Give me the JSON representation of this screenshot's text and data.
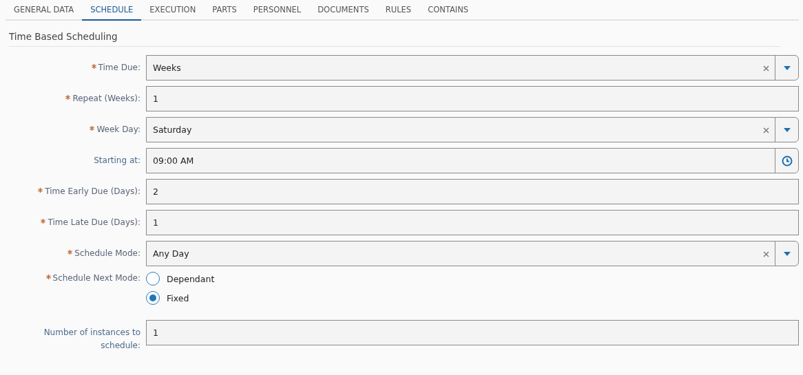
{
  "tabs": [
    {
      "label": "GENERAL DATA",
      "selected": false
    },
    {
      "label": "SCHEDULE",
      "selected": true
    },
    {
      "label": "EXECUTION",
      "selected": false
    },
    {
      "label": "PARTS",
      "selected": false
    },
    {
      "label": "PERSONNEL",
      "selected": false
    },
    {
      "label": "DOCUMENTS",
      "selected": false
    },
    {
      "label": "RULES",
      "selected": false
    },
    {
      "label": "CONTAINS",
      "selected": false
    }
  ],
  "section": {
    "title": "Time Based Scheduling"
  },
  "fields": [
    {
      "kind": "select",
      "label": "Time Due:",
      "required": true,
      "value": "Weeks"
    },
    {
      "kind": "text",
      "label": "Repeat (Weeks):",
      "required": true,
      "value": "1"
    },
    {
      "kind": "select",
      "label": "Week Day:",
      "required": true,
      "value": "Saturday"
    },
    {
      "kind": "time",
      "label": "Starting at:",
      "required": false,
      "value": "09:00 AM"
    },
    {
      "kind": "text",
      "label": "Time Early Due (Days):",
      "required": true,
      "value": "2"
    },
    {
      "kind": "text",
      "label": "Time Late Due (Days):",
      "required": true,
      "value": "1"
    },
    {
      "kind": "select",
      "label": "Schedule Mode:",
      "required": true,
      "value": "Any Day"
    },
    {
      "kind": "radio",
      "label": "Schedule Next Mode:",
      "required": true,
      "options": [
        {
          "label": "Dependant",
          "selected": false
        },
        {
          "label": "Fixed",
          "selected": true
        }
      ]
    },
    {
      "kind": "text",
      "label": "Number of instances to schedule:",
      "required": false,
      "value": "1"
    }
  ]
}
